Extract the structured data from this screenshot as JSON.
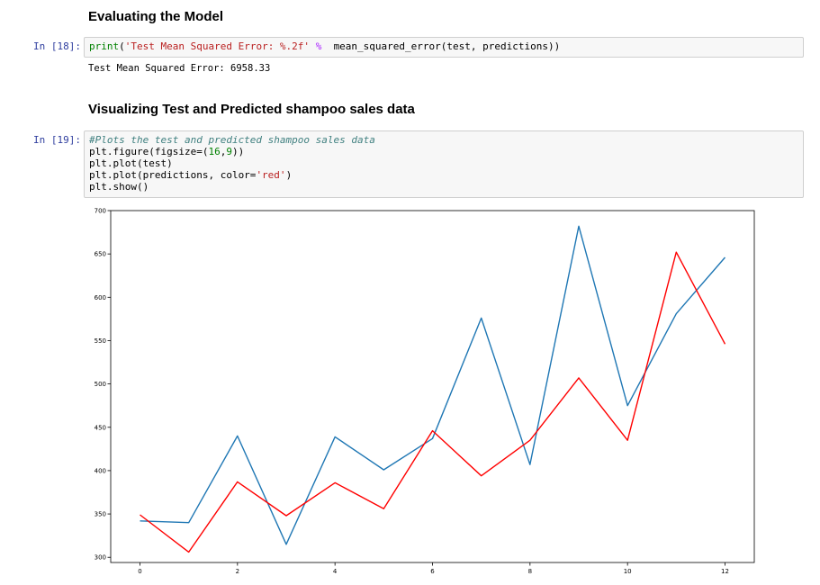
{
  "headings": {
    "evaluating": "Evaluating the Model",
    "visualizing": "Visualizing Test and Predicted shampoo sales data"
  },
  "cell18": {
    "prompt": "In [18]:",
    "code": {
      "fn": "print",
      "lparen": "(",
      "string": "'Test Mean Squared Error: %.2f'",
      "op": "%",
      "rest": "mean_squared_error(test, predictions))"
    },
    "output": "Test Mean Squared Error: 6958.33"
  },
  "cell19": {
    "prompt": "In [19]:",
    "line1": "#Plots the test and predicted shampoo sales data",
    "line2_pre": "plt.figure(figsize=(",
    "line2_num1": "16",
    "line2_mid": ",",
    "line2_num2": "9",
    "line2_post": "))",
    "line3": "plt.plot(test)",
    "line4_pre": "plt.plot(predictions, color=",
    "line4_str": "'red'",
    "line4_post": ")",
    "line5": "plt.show()"
  },
  "chart_data": {
    "type": "line",
    "x": [
      0,
      1,
      2,
      3,
      4,
      5,
      6,
      7,
      8,
      9,
      10,
      11,
      12
    ],
    "series": [
      {
        "values": [
          342,
          340,
          440,
          315,
          439,
          401,
          437,
          576,
          407,
          682,
          475,
          581,
          646
        ],
        "color": "#1f77b4"
      },
      {
        "values": [
          349,
          306,
          387,
          348,
          386,
          356,
          446,
          394,
          435,
          507,
          435,
          652,
          546
        ],
        "color": "#ff0000"
      }
    ],
    "xlim": [
      -0.6,
      12.6
    ],
    "ylim": [
      294,
      700
    ],
    "xticks": [
      0,
      2,
      4,
      6,
      8,
      10,
      12
    ],
    "yticks": [
      300,
      350,
      400,
      450,
      500,
      550,
      600,
      650,
      700
    ],
    "grid": false
  }
}
